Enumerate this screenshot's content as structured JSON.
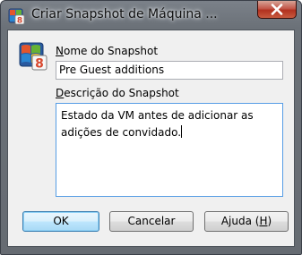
{
  "window": {
    "title": "Criar Snapshot de Máquina ...",
    "icon": "virtualbox-icon",
    "close_icon": "close-icon"
  },
  "form": {
    "vm_icon": "vm-os-icon",
    "name_label_accel": "N",
    "name_label_rest": "ome do Snapshot",
    "name_value": "Pre Guest additions",
    "desc_label_accel": "D",
    "desc_label_rest": "escrição do Snapshot",
    "desc_line1": "Estado da VM antes de adicionar as",
    "desc_line2": "adições de convidado."
  },
  "buttons": {
    "ok": "OK",
    "cancel": "Cancelar",
    "help_prefix": "Ajuda (",
    "help_accel": "H",
    "help_suffix": ")"
  },
  "colors": {
    "titlebar": "#6b7178",
    "client_bg": "#f0f0f0",
    "close_red": "#c3584a",
    "focus_border": "#569de5"
  }
}
